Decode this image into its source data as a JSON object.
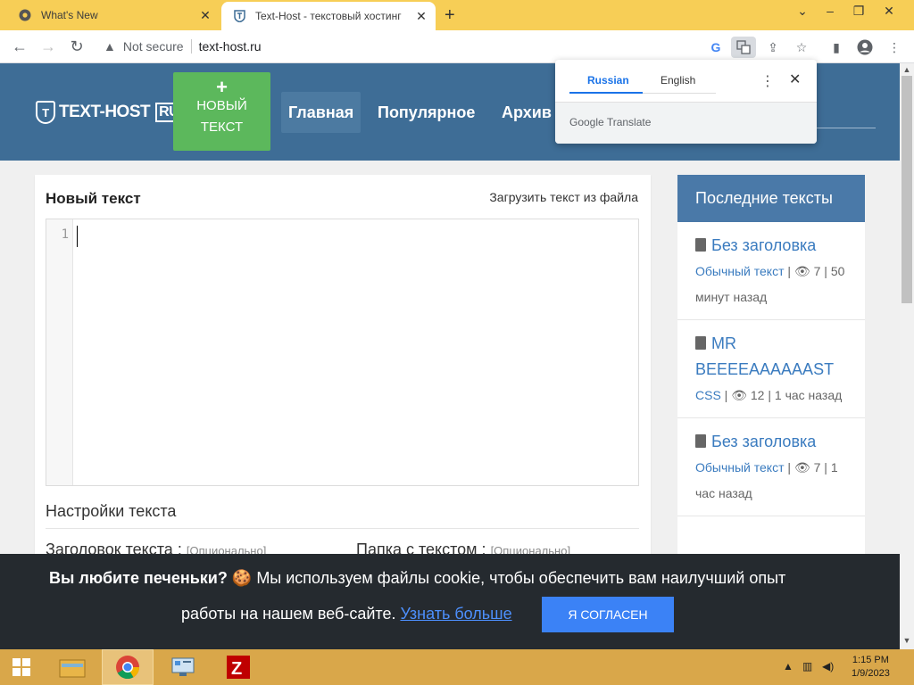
{
  "browser": {
    "tabs": [
      {
        "title": "What's New",
        "active": false
      },
      {
        "title": "Text-Host - текстовый хостинг",
        "active": true
      }
    ],
    "security_label": "Not secure",
    "url": "text-host.ru"
  },
  "site": {
    "logo_text": "TEXT-HOST",
    "logo_badge": "RU",
    "logo_shield": "T",
    "new_button_plus": "+",
    "new_button_line1": "НОВЫЙ",
    "new_button_line2": "ТЕКСТ",
    "nav": [
      "Главная",
      "Популярное",
      "Архив"
    ]
  },
  "editor": {
    "title": "Новый текст",
    "upload_link": "Загрузить текст из файла",
    "line_number": "1",
    "settings_title": "Настройки текста",
    "field_title_label": "Заголовок текста :",
    "field_title_optional": "[Опционально]",
    "field_folder_label": "Папка с текстом :",
    "field_folder_optional": "[Опционально]"
  },
  "sidebar": {
    "heading": "Последние тексты",
    "items": [
      {
        "title": "Без заголовка",
        "type": "Обычный текст",
        "views": "7",
        "time": "50 минут назад"
      },
      {
        "title": "MR BEEEEAAAAAAST",
        "type": "CSS",
        "views": "12",
        "time": "1 час назад"
      },
      {
        "title": "Без заголовка",
        "type": "Обычный текст",
        "views": "7",
        "time": "1 час назад"
      }
    ]
  },
  "translate": {
    "lang_from": "Russian",
    "lang_to": "English",
    "brand": "Google Translate"
  },
  "cookie": {
    "bold": "Вы любите печеньки?",
    "text1": "Мы используем файлы cookie, чтобы обеспечить вам наилучший опыт",
    "text2": "работы на нашем веб-сайте.",
    "link": "Узнать больше",
    "button": "Я СОГЛАСЕН"
  },
  "taskbar": {
    "time": "1:15 PM",
    "date": "1/9/2023"
  },
  "colors": {
    "header": "#3e6d96",
    "new_button": "#5cb85c",
    "link": "#3a7bbf",
    "cookie_bg": "#252a2f",
    "cookie_button": "#3b82f6",
    "tabstrip": "#f7ce56"
  }
}
